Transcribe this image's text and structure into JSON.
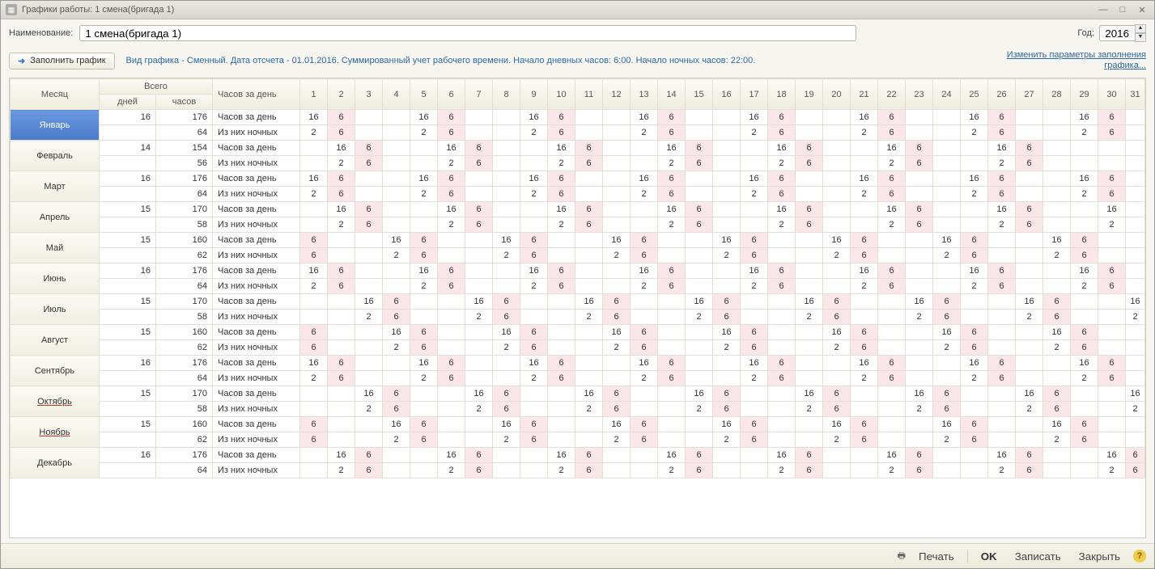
{
  "window": {
    "title": "Графики работы: 1 смена(бригада 1)"
  },
  "labels": {
    "name": "Наименование:",
    "year": "Год:",
    "fill": "Заполнить график",
    "desc": "Вид графика - Сменный. Дата отсчета - 01.01.2016. Суммированный учет рабочего времени. Начало дневных часов: 6:00. Начало ночных часов: 22:00.",
    "change_link": "Изменить параметры заполнения графика...",
    "month": "Месяц",
    "total": "Всего",
    "days": "дней",
    "hours": "часов",
    "per_day": "Часов за день",
    "row_hours": "Часов за день",
    "row_night": "Из них ночных"
  },
  "form": {
    "name": "1 смена(бригада 1)",
    "year": "2016"
  },
  "footer": {
    "print": "Печать",
    "ok": "OK",
    "save": "Записать",
    "close": "Закрыть"
  },
  "pattern": [
    "16",
    "6",
    "",
    "",
    "16",
    "6",
    "",
    "",
    "16",
    "6",
    "",
    "",
    "16",
    "6",
    "",
    "",
    "16",
    "6",
    "",
    "",
    "16",
    "6",
    "",
    "",
    "16",
    "6",
    "",
    "",
    "16",
    "6",
    ""
  ],
  "pattern_n": [
    "2",
    "6",
    "",
    "",
    "2",
    "6",
    "",
    "",
    "2",
    "6",
    "",
    "",
    "2",
    "6",
    "",
    "",
    "2",
    "6",
    "",
    "",
    "2",
    "6",
    "",
    "",
    "2",
    "6",
    "",
    "",
    "2",
    "6",
    ""
  ],
  "months": [
    {
      "name": "Январь",
      "sel": true,
      "days": 16,
      "hours": 176,
      "night": 64,
      "offset": 0,
      "lastDay": 31
    },
    {
      "name": "Февраль",
      "days": 14,
      "hours": 154,
      "night": 56,
      "offset": 1,
      "lastDay": 29
    },
    {
      "name": "Март",
      "days": 16,
      "hours": 176,
      "night": 64,
      "offset": 0,
      "lastDay": 31
    },
    {
      "name": "Апрель",
      "days": 15,
      "hours": 170,
      "night": 58,
      "offset": 1,
      "lastDay": 30
    },
    {
      "name": "Май",
      "days": 15,
      "hours": 160,
      "night": 62,
      "offset": 3,
      "lastDay": 31
    },
    {
      "name": "Июнь",
      "days": 16,
      "hours": 176,
      "night": 64,
      "offset": 0,
      "lastDay": 30
    },
    {
      "name": "Июль",
      "days": 15,
      "hours": 170,
      "night": 58,
      "offset": 2,
      "lastDay": 31
    },
    {
      "name": "Август",
      "days": 15,
      "hours": 160,
      "night": 62,
      "offset": 3,
      "lastDay": 31
    },
    {
      "name": "Сентябрь",
      "days": 16,
      "hours": 176,
      "night": 64,
      "offset": 0,
      "lastDay": 30
    },
    {
      "name": "Октябрь",
      "ul": true,
      "days": 15,
      "hours": 170,
      "night": 58,
      "offset": 2,
      "lastDay": 31
    },
    {
      "name": "Ноябрь",
      "ul": true,
      "days": 15,
      "hours": 160,
      "night": 62,
      "offset": 3,
      "lastDay": 30
    },
    {
      "name": "Декабрь",
      "days": 16,
      "hours": 176,
      "night": 64,
      "offset": 1,
      "lastDay": 31
    }
  ]
}
